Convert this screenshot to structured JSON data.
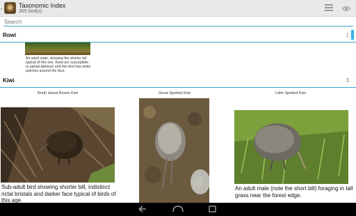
{
  "app": {
    "title": "Taxonomic Index",
    "subtitle": "365 bird(s)",
    "icons": [
      "app-kiwi-icon",
      "list-view-icon",
      "eye-icon"
    ]
  },
  "search": {
    "placeholder": "Search",
    "value": ""
  },
  "sections": [
    {
      "title": "Rowi",
      "count": "1"
    },
    {
      "title": "Kiwi",
      "count": "3"
    }
  ],
  "rowi": {
    "caption": "An adult male, showing the shorter bill typical of this sex. Rowi are susceptible to partial albinism and this bird has white patches around the face."
  },
  "kiwi_entries": [
    {
      "name": "North Island Brown Kiwi",
      "caption": "Sub-adult bird showing shorter bill, indistinct rictal bristals and darker face typical of birds of this age."
    },
    {
      "name": "Great Spotted Kiwi",
      "caption": ""
    },
    {
      "name": "Little Spotted Kiwi",
      "caption": "An adult male (note the short bill) foraging in tall grass near the forest edge."
    }
  ],
  "colors": {
    "accent": "#33b5e5",
    "divider": "#38a7cc",
    "actionbar": "#e9e9e9",
    "navbar": "#000000"
  },
  "navigation": [
    "back-icon",
    "home-icon",
    "recents-icon"
  ]
}
